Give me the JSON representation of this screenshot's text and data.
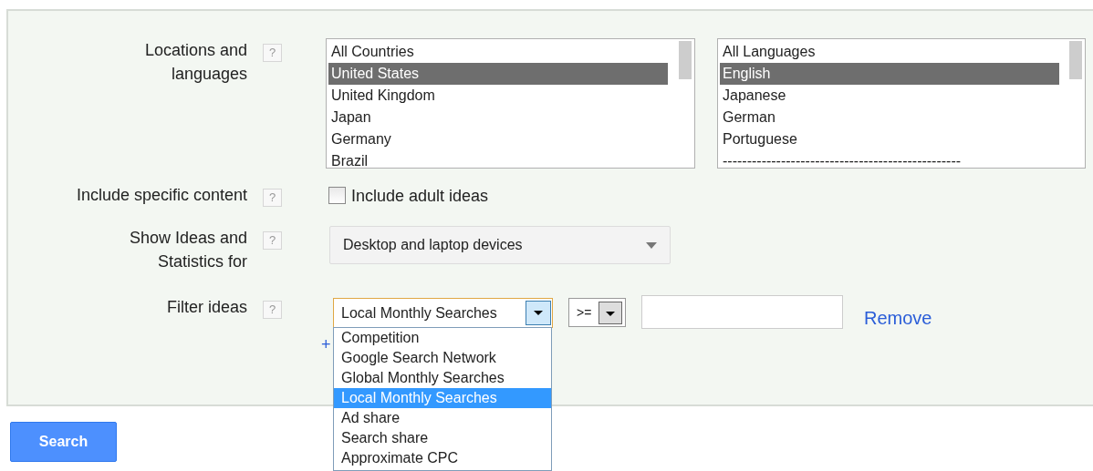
{
  "locations_and_languages": {
    "label": "Locations and languages",
    "help": "?",
    "locations": [
      {
        "label": "All Countries",
        "selected": false
      },
      {
        "label": "United States",
        "selected": true
      },
      {
        "label": "United Kingdom",
        "selected": false
      },
      {
        "label": "Japan",
        "selected": false
      },
      {
        "label": "Germany",
        "selected": false
      },
      {
        "label": "Brazil",
        "selected": false
      }
    ],
    "languages": [
      {
        "label": "All Languages",
        "selected": false
      },
      {
        "label": "English",
        "selected": true
      },
      {
        "label": "Japanese",
        "selected": false
      },
      {
        "label": "German",
        "selected": false
      },
      {
        "label": "Portuguese",
        "selected": false
      },
      {
        "label": "-------------------------------------------------",
        "selected": false
      }
    ]
  },
  "include_specific_content": {
    "label": "Include specific content",
    "help": "?",
    "checkbox": {
      "label": "Include adult ideas",
      "checked": false
    }
  },
  "show_ideas": {
    "label": "Show Ideas and Statistics for",
    "help": "?",
    "value": "Desktop and laptop devices"
  },
  "filter_ideas": {
    "label": "Filter ideas",
    "help": "?",
    "field": "Local Monthly Searches",
    "operator": ">=",
    "add_link": "+",
    "remove": "Remove",
    "options": [
      {
        "label": "Competition",
        "selected": false
      },
      {
        "label": "Google Search Network",
        "selected": false
      },
      {
        "label": "Global Monthly Searches",
        "selected": false
      },
      {
        "label": "Local Monthly Searches",
        "selected": true
      },
      {
        "label": "Ad share",
        "selected": false
      },
      {
        "label": "Search share",
        "selected": false
      },
      {
        "label": "Approximate CPC",
        "selected": false
      }
    ]
  },
  "search_button": "Search"
}
